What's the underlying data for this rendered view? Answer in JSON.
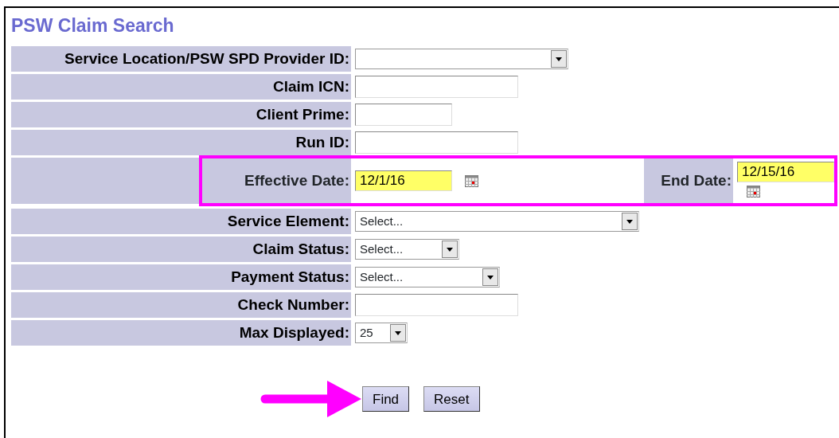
{
  "title": "PSW Claim Search",
  "fields": [
    {
      "kind": "select",
      "label": "Service Location/PSW SPD Provider ID:"
    },
    {
      "kind": "text",
      "label": "Claim ICN:"
    },
    {
      "kind": "text",
      "label": "Client Prime:"
    },
    {
      "kind": "text",
      "label": "Run ID:"
    },
    {
      "kind": "date_range",
      "highlighted": true,
      "dates": [
        {
          "label": "Effective Date:",
          "value": "12/1/16"
        },
        {
          "label": "End Date:",
          "value": "12/15/16"
        }
      ]
    },
    {
      "kind": "select",
      "label": "Service Element:",
      "value": "Select..."
    },
    {
      "kind": "select",
      "label": "Claim Status:",
      "value": "Select..."
    },
    {
      "kind": "select",
      "label": "Payment Status:",
      "value": "Select..."
    },
    {
      "kind": "text",
      "label": "Check Number:"
    },
    {
      "kind": "select",
      "label": "Max Displayed:",
      "value": "25"
    }
  ],
  "buttons": [
    {
      "label": "Find",
      "pointed": true
    },
    {
      "label": "Reset",
      "pointed": false
    }
  ]
}
